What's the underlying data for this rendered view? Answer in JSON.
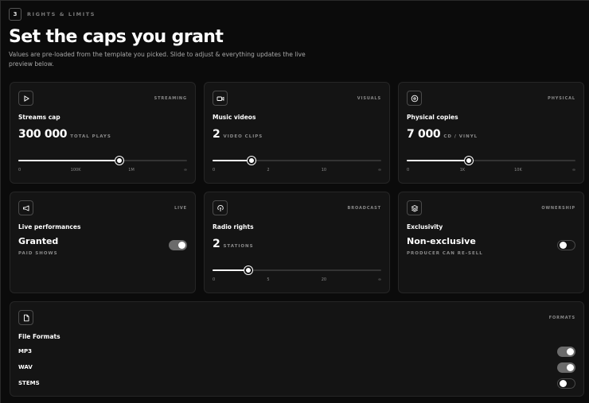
{
  "header": {
    "step_number": "3",
    "step_label": "RIGHTS & LIMITS",
    "title": "Set the caps you grant",
    "subtitle": "Values are pre-loaded from the template you picked. Slide to adjust & everything updates the live preview below."
  },
  "cards": {
    "streaming": {
      "icon": "play-icon",
      "tag": "STREAMING",
      "title": "Streams cap",
      "value": "300 000",
      "unit": "TOTAL PLAYS",
      "slider_fraction": 0.6,
      "ticks": [
        "0",
        "100K",
        "1M",
        "∞"
      ]
    },
    "visuals": {
      "icon": "video-camera-icon",
      "tag": "VISUALS",
      "title": "Music videos",
      "value": "2",
      "unit": "VIDEO CLIPS",
      "slider_fraction": 0.23,
      "ticks": [
        "0",
        "2",
        "10",
        "∞"
      ]
    },
    "physical": {
      "icon": "disc-icon",
      "tag": "PHYSICAL",
      "title": "Physical copies",
      "value": "7 000",
      "unit": "CD / VINYL",
      "slider_fraction": 0.37,
      "ticks": [
        "0",
        "1K",
        "10K",
        "∞"
      ]
    },
    "live": {
      "icon": "megaphone-icon",
      "tag": "LIVE",
      "title": "Live performances",
      "status": "Granted",
      "status_sub": "PAID SHOWS",
      "toggle_on": true
    },
    "broadcast": {
      "icon": "antenna-icon",
      "tag": "BROADCAST",
      "title": "Radio rights",
      "value": "2",
      "unit": "STATIONS",
      "slider_fraction": 0.21,
      "ticks": [
        "0",
        "5",
        "20",
        "∞"
      ]
    },
    "ownership": {
      "icon": "layers-icon",
      "tag": "OWNERSHIP",
      "title": "Exclusivity",
      "status": "Non-exclusive",
      "status_sub": "PRODUCER CAN RE-SELL",
      "toggle_on": false
    }
  },
  "formats": {
    "icon": "file-icon",
    "tag": "FORMATS",
    "title": "File Formats",
    "items": [
      {
        "label": "MP3",
        "on": true
      },
      {
        "label": "WAV",
        "on": true
      },
      {
        "label": "STEMS",
        "on": false
      }
    ]
  }
}
